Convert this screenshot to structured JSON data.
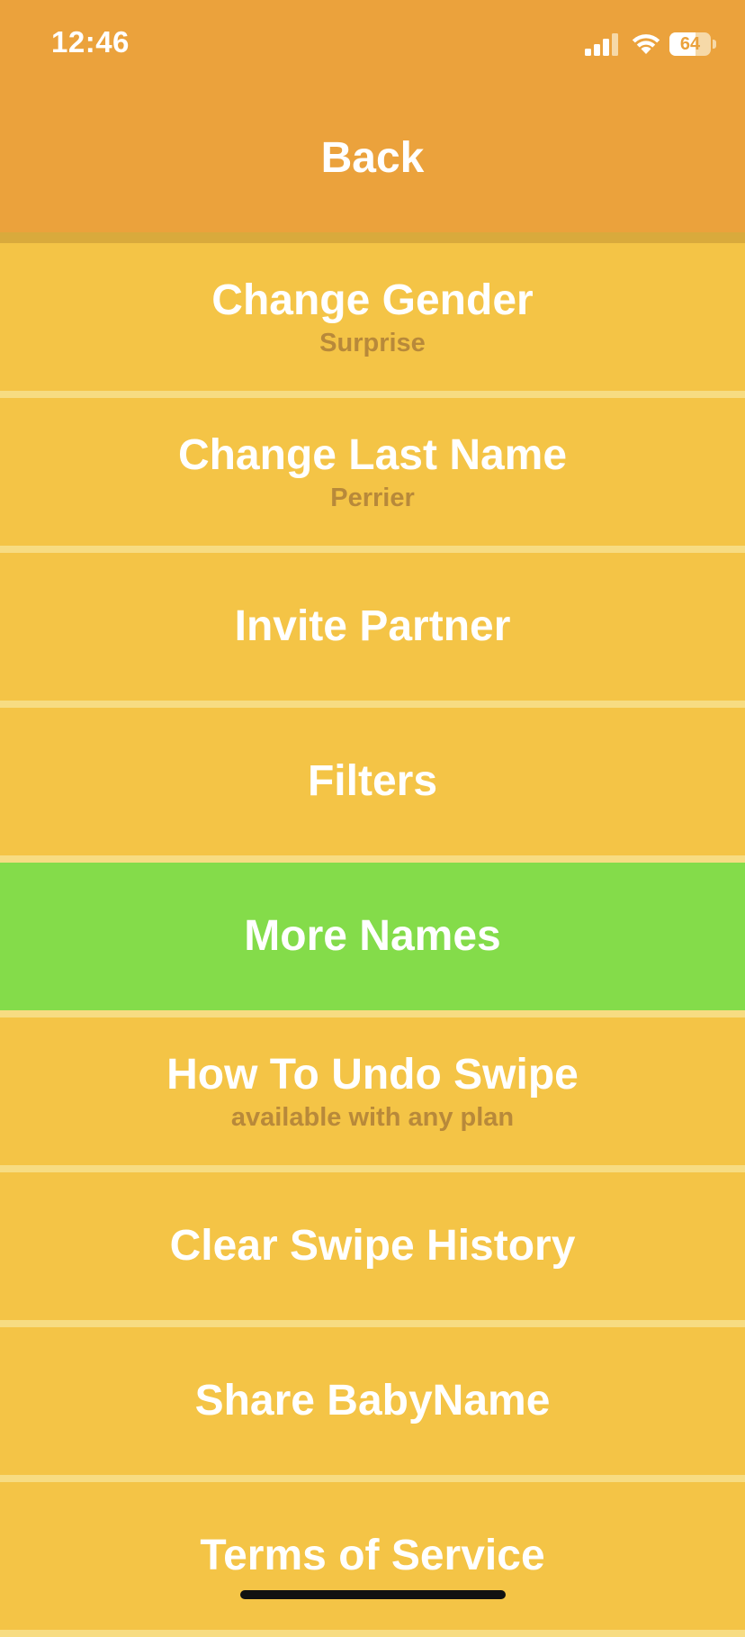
{
  "status_bar": {
    "time": "12:46",
    "battery_level": "64",
    "battery_percent": 64,
    "signal_icon": "cellular-signal-icon",
    "wifi_icon": "wifi-icon"
  },
  "header": {
    "back_label": "Back",
    "background_color": "#eba23c"
  },
  "menu": {
    "items": [
      {
        "label": "Change Gender",
        "sub": "Surprise"
      },
      {
        "label": "Change Last Name",
        "sub": "Perrier"
      },
      {
        "label": "Invite Partner",
        "sub": ""
      },
      {
        "label": "Filters",
        "sub": ""
      },
      {
        "label": "More Names",
        "sub": "",
        "highlight": true
      },
      {
        "label": "How To Undo Swipe",
        "sub": "available with any plan"
      },
      {
        "label": "Clear Swipe History",
        "sub": ""
      },
      {
        "label": "Share BabyName",
        "sub": ""
      },
      {
        "label": "Terms of Service",
        "sub": ""
      }
    ],
    "item_color": "#f4c446",
    "highlight_color": "#84dc4a",
    "subtext_color": "#b8893a"
  }
}
